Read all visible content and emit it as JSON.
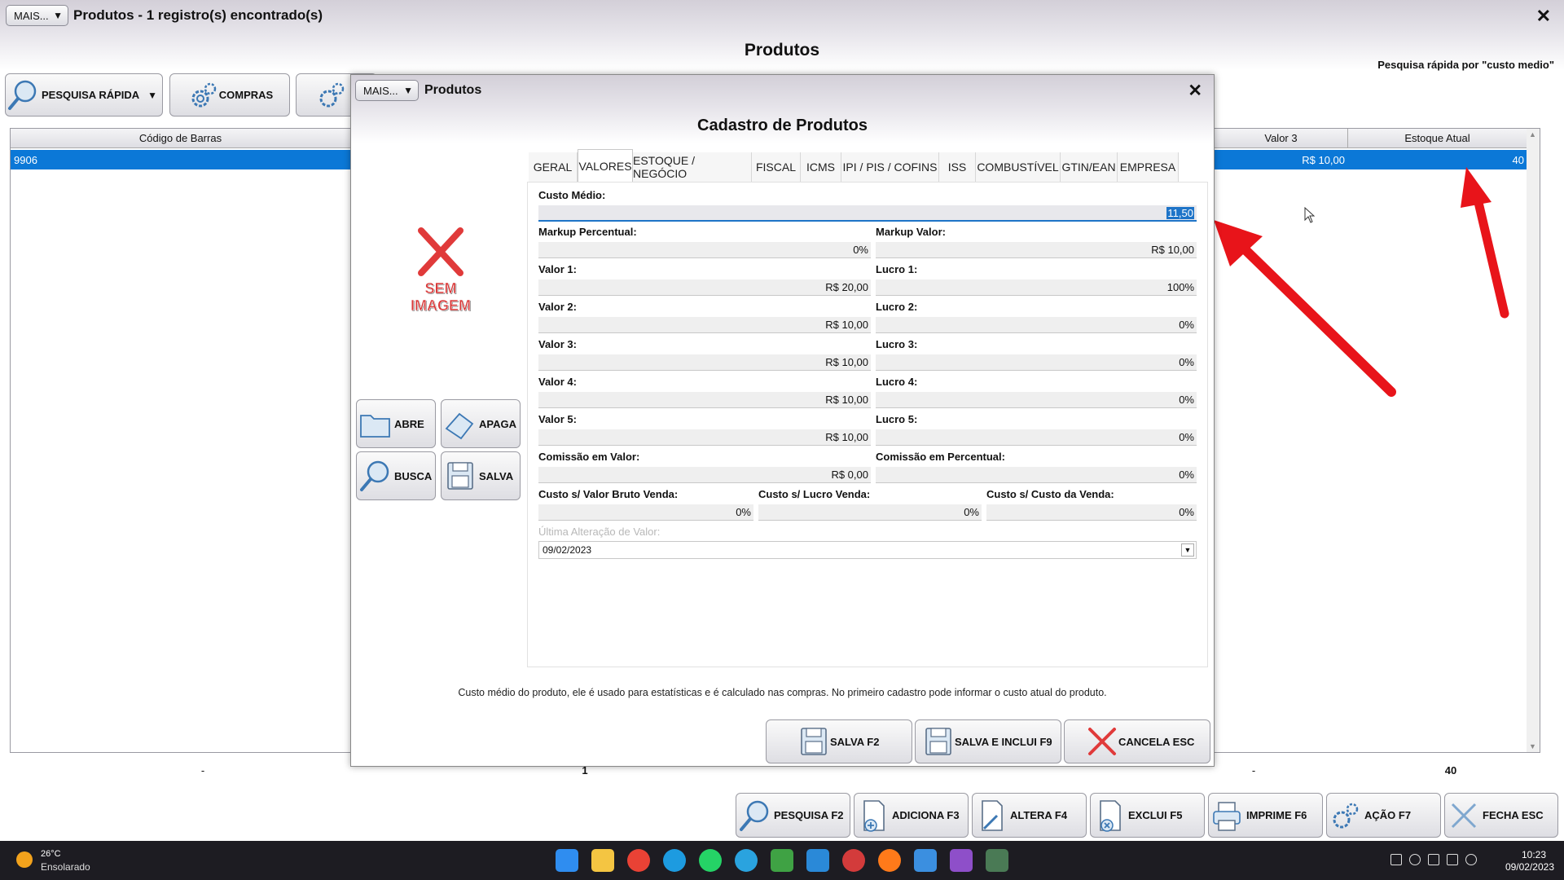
{
  "main": {
    "mais_label": "MAIS...",
    "title": "Produtos - 1 registro(s) encontrado(s)",
    "heading": "Produtos",
    "quick_search_note": "Pesquisa rápida por \"custo medio\"",
    "toolbar": {
      "pesquisa_rapida": "PESQUISA RÁPIDA",
      "compras": "COMPRAS"
    },
    "grid": {
      "headers": {
        "codigo_barras": "Código de Barras",
        "valor3": "Valor 3",
        "estoque": "Estoque Atual"
      },
      "row": {
        "codigo_barras": "9906",
        "valor3": "R$ 10,00",
        "estoque": "40"
      },
      "footer": {
        "count": "1",
        "estoque_total": "40",
        "dash": "-"
      }
    },
    "bottom_toolbar": {
      "pesquisa": "PESQUISA F2",
      "adiciona": "ADICIONA F3",
      "altera": "ALTERA F4",
      "exclui": "EXCLUI F5",
      "imprime": "IMPRIME F6",
      "acao": "AÇÃO F7",
      "fecha": "FECHA ESC"
    }
  },
  "dialog": {
    "mais_label": "MAIS...",
    "title": "Produtos",
    "heading": "Cadastro de Produtos",
    "no_image": [
      "SEM",
      "IMAGEM"
    ],
    "side_buttons": {
      "abre": "ABRE",
      "apaga": "APAGA",
      "busca": "BUSCA",
      "salva": "SALVA"
    },
    "tabs": [
      "GERAL",
      "VALORES",
      "ESTOQUE / NEGÓCIO",
      "FISCAL",
      "ICMS",
      "IPI / PIS / COFINS",
      "ISS",
      "COMBUSTÍVEL",
      "GTIN/EAN",
      "EMPRESA"
    ],
    "active_tab": "VALORES",
    "fields": {
      "custo_medio": {
        "label": "Custo Médio:",
        "value": "11,50"
      },
      "markup_percentual": {
        "label": "Markup Percentual:",
        "value": "0%"
      },
      "markup_valor": {
        "label": "Markup Valor:",
        "value": "R$ 10,00"
      },
      "valor1": {
        "label": "Valor 1:",
        "value": "R$ 20,00"
      },
      "lucro1": {
        "label": "Lucro 1:",
        "value": "100%"
      },
      "valor2": {
        "label": "Valor 2:",
        "value": "R$ 10,00"
      },
      "lucro2": {
        "label": "Lucro 2:",
        "value": "0%"
      },
      "valor3": {
        "label": "Valor 3:",
        "value": "R$ 10,00"
      },
      "lucro3": {
        "label": "Lucro 3:",
        "value": "0%"
      },
      "valor4": {
        "label": "Valor 4:",
        "value": "R$ 10,00"
      },
      "lucro4": {
        "label": "Lucro 4:",
        "value": "0%"
      },
      "valor5": {
        "label": "Valor 5:",
        "value": "R$ 10,00"
      },
      "lucro5": {
        "label": "Lucro 5:",
        "value": "0%"
      },
      "comissao_valor": {
        "label": "Comissão em Valor:",
        "value": "R$ 0,00"
      },
      "comissao_percentual": {
        "label": "Comissão em Percentual:",
        "value": "0%"
      },
      "custo_bruto": {
        "label": "Custo s/ Valor Bruto Venda:",
        "value": "0%"
      },
      "custo_lucro": {
        "label": "Custo s/ Lucro Venda:",
        "value": "0%"
      },
      "custo_custo": {
        "label": "Custo s/ Custo da Venda:",
        "value": "0%"
      },
      "ultima_alteracao": {
        "label": "Última Alteração de Valor:",
        "value": "09/02/2023"
      }
    },
    "hint": "Custo médio do produto, ele é usado para estatísticas e é calculado nas compras. No primeiro cadastro pode informar o custo atual do produto.",
    "actions": {
      "salva": "SALVA F2",
      "salva_inclui": "SALVA E INCLUI F9",
      "cancela": "CANCELA ESC"
    }
  },
  "taskbar": {
    "temperature": "26°C",
    "weather": "Ensolarado",
    "time": "10:23",
    "date": "09/02/2023"
  },
  "colors": {
    "selection": "#0b78d7",
    "annotation_arrow": "#e8141a",
    "focus": "#1e74c8"
  }
}
